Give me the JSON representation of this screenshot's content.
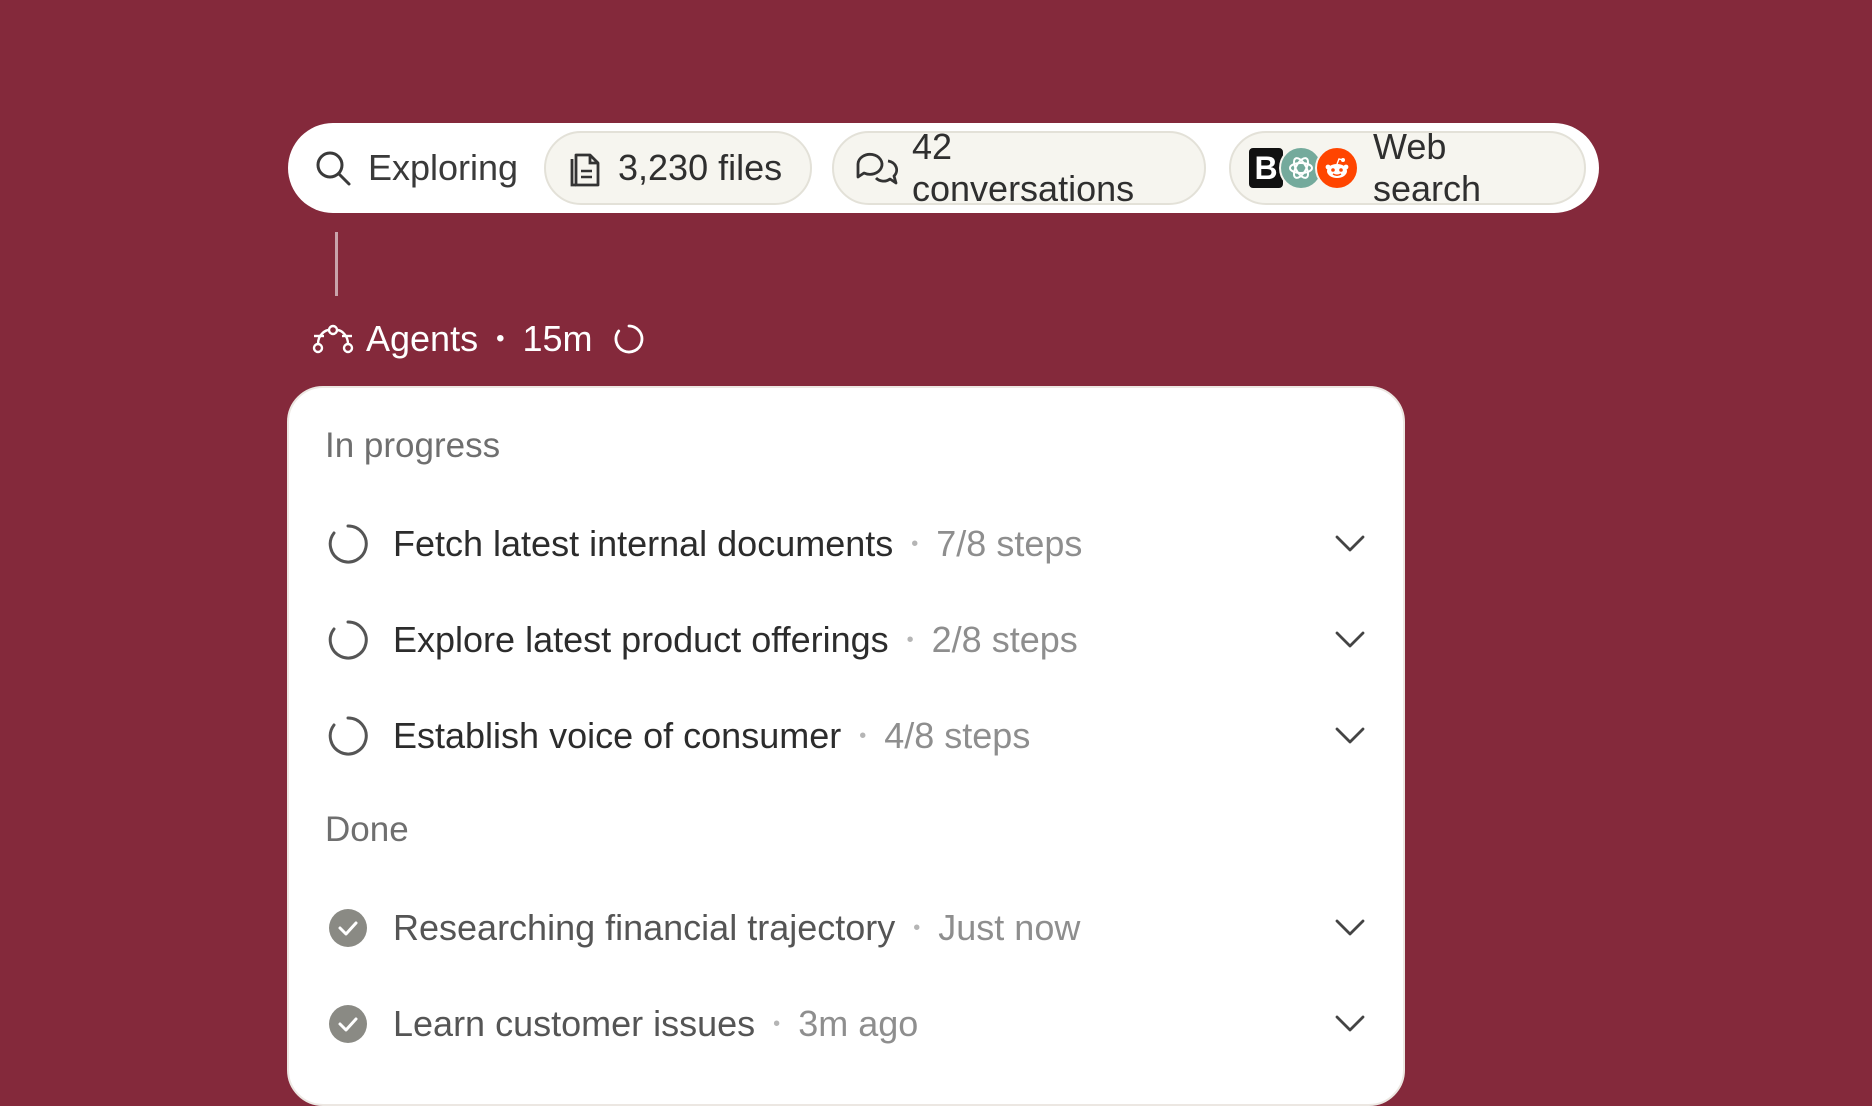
{
  "toolbar": {
    "explore_label": "Exploring",
    "files_label": "3,230 files",
    "conversations_label": "42 conversations",
    "web_label": "Web search",
    "logo_b": "B"
  },
  "agents": {
    "label": "Agents",
    "elapsed": "15m"
  },
  "sections": {
    "in_progress": "In progress",
    "done": "Done"
  },
  "tasks_in_progress": [
    {
      "title": "Fetch latest internal documents",
      "meta": "7/8 steps"
    },
    {
      "title": "Explore latest product offerings",
      "meta": "2/8 steps"
    },
    {
      "title": "Establish voice of consumer",
      "meta": "4/8 steps"
    }
  ],
  "tasks_done": [
    {
      "title": "Researching financial trajectory",
      "meta": "Just now"
    },
    {
      "title": "Learn customer issues",
      "meta": "3m ago"
    }
  ],
  "colors": {
    "background": "#84293b",
    "chip_bg": "#f6f5ef",
    "done_check": "#8a8a84"
  }
}
